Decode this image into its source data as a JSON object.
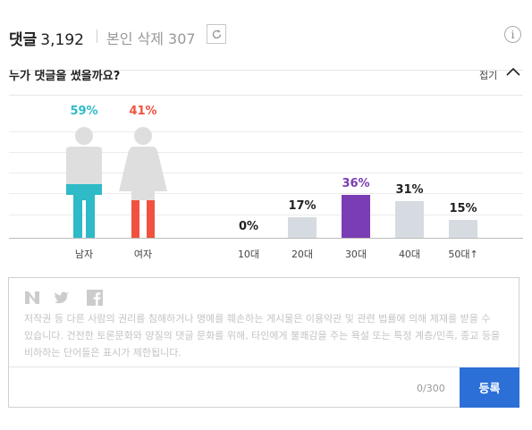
{
  "header": {
    "comment_label": "댓글",
    "comment_count": "3,192",
    "deleted_label": "본인 삭제 307",
    "info_label": "i"
  },
  "stats": {
    "question": "누가 댓글을 썼을까요?",
    "collapse_label": "접기"
  },
  "colors": {
    "male": "#2ebac6",
    "female": "#f0523f",
    "age_highlight": "#7a3db3",
    "age_bar": "#d5dbe0",
    "submit": "#2c6fd6"
  },
  "chart_data": {
    "type": "bar",
    "gender": {
      "categories": [
        "남자",
        "여자"
      ],
      "values": [
        59,
        41
      ],
      "labels": [
        "59%",
        "41%"
      ]
    },
    "age": {
      "categories": [
        "10대",
        "20대",
        "30대",
        "40대",
        "50대↑"
      ],
      "values": [
        0,
        17,
        36,
        31,
        15
      ],
      "labels": [
        "0%",
        "17%",
        "36%",
        "31%",
        "15%"
      ],
      "highlight": "30대",
      "ylim": [
        0,
        36
      ]
    }
  },
  "comment_form": {
    "social_icons": [
      "naver-icon",
      "twitter-icon",
      "facebook-icon"
    ],
    "notice": "저작권 등 다른 사람의 권리를 침해하거나 명예를 훼손하는 게시물은 이용약관 및 관련 법률에 의해 제재를 받을 수 있습니다. 건전한 토론문화와 양질의 댓글 문화를 위해, 타인에게 불쾌감을 주는 욕설 또는 특정 계층/민족, 종교 등을 비하하는 단어들은 표시가 제한됩니다.",
    "char_count": "0/300",
    "submit_label": "등록"
  }
}
